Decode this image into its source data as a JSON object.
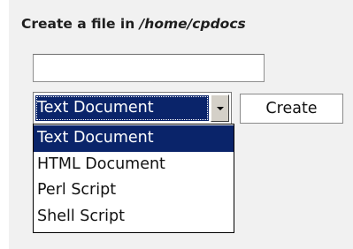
{
  "form": {
    "heading_prefix": "Create a file in ",
    "heading_path": "/home/cpdocs",
    "filename_value": "",
    "filename_placeholder": "",
    "selected_type": "Text Document",
    "create_label": "Create"
  },
  "dropdown": {
    "options": [
      {
        "label": "Text Document",
        "highlighted": true
      },
      {
        "label": "HTML Document",
        "highlighted": false
      },
      {
        "label": "Perl Script",
        "highlighted": false
      },
      {
        "label": "Shell Script",
        "highlighted": false
      }
    ]
  },
  "colors": {
    "panel_background": "#f1f1f1",
    "selection_background": "#0a246a",
    "selection_text": "#ffffff"
  },
  "icons": {
    "select_arrow": "chevron-down-icon"
  }
}
